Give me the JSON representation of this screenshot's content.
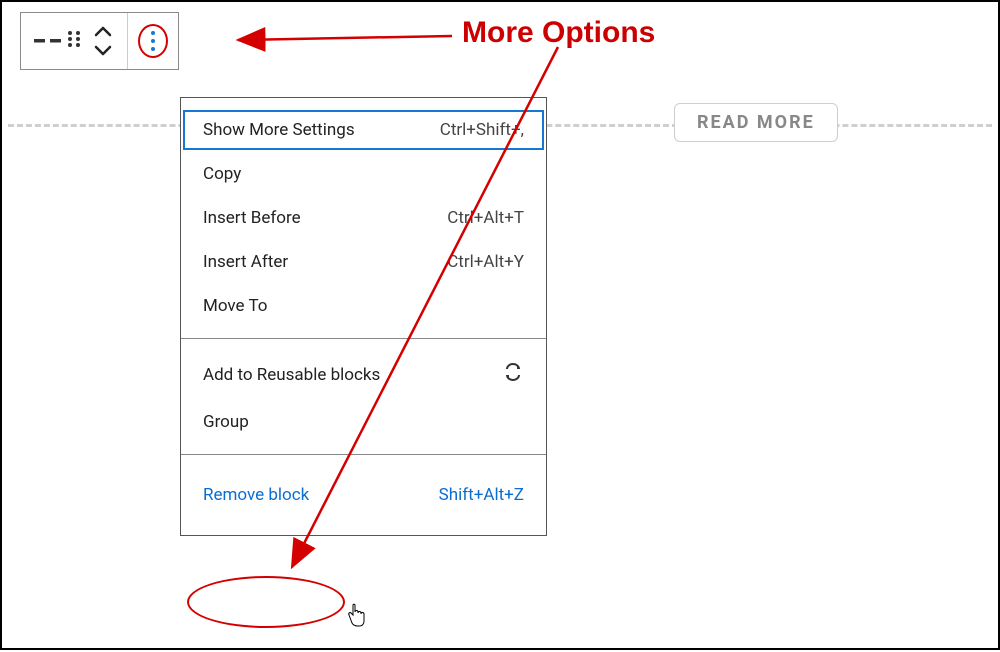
{
  "annotation": {
    "label": "More Options"
  },
  "toolbar": {
    "block_icon": "horizontal-rule-icon",
    "drag_icon": "drag-handle-icon",
    "move_up_icon": "chevron-up-icon",
    "move_down_icon": "chevron-down-icon",
    "more_icon": "more-vertical-icon"
  },
  "read_more": {
    "label": "READ MORE"
  },
  "menu": {
    "sections": [
      {
        "items": [
          {
            "label": "Show More Settings",
            "shortcut": "Ctrl+Shift+,",
            "highlight": true
          },
          {
            "label": "Copy",
            "shortcut": ""
          },
          {
            "label": "Insert Before",
            "shortcut": "Ctrl+Alt+T"
          },
          {
            "label": "Insert After",
            "shortcut": "Ctrl+Alt+Y"
          },
          {
            "label": "Move To",
            "shortcut": ""
          }
        ]
      },
      {
        "items": [
          {
            "label": "Add to Reusable blocks",
            "shortcut": "",
            "right_icon": "convert-icon"
          },
          {
            "label": "Group",
            "shortcut": ""
          }
        ]
      },
      {
        "items": [
          {
            "label": "Remove block",
            "shortcut": "Shift+Alt+Z",
            "danger": true
          }
        ]
      }
    ]
  },
  "colors": {
    "annotation": "#cc0000",
    "accent": "#1578d4"
  }
}
